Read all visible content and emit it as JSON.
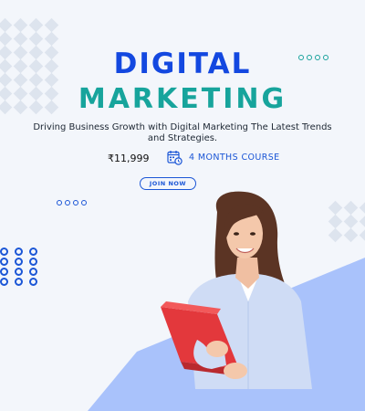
{
  "headline": {
    "line1": "DIGITAL",
    "line2": "MARKETING"
  },
  "tagline": "Driving Business Growth with Digital Marketing The Latest Trends and Strategies.",
  "offer": {
    "price": "₹11,999",
    "duration": "4 MONTHS COURSE",
    "duration_icon": "calendar-icon"
  },
  "cta": {
    "label": "JOIN NOW"
  },
  "colors": {
    "background": "#f3f6fb",
    "primary_blue": "#1348e0",
    "teal": "#17a49c",
    "band_blue": "#a9c2fb",
    "folder_red": "#e3383c"
  }
}
